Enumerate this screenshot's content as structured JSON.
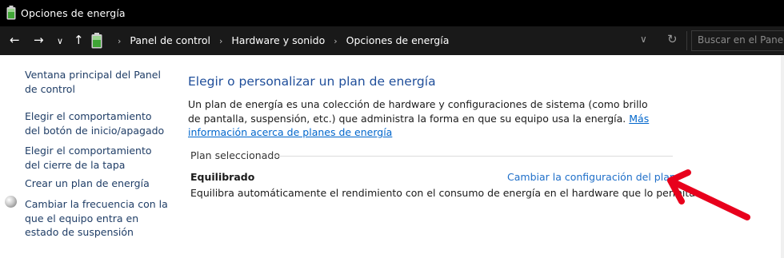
{
  "window": {
    "title": "Opciones de energía"
  },
  "nav": {
    "back_glyph": "←",
    "forward_glyph": "→",
    "history_glyph": "∨",
    "up_glyph": "↑",
    "breadcrumb": [
      "Panel de control",
      "Hardware y sonido",
      "Opciones de energía"
    ],
    "separator": "›",
    "dropdown_glyph": "∨",
    "refresh_glyph": "↻"
  },
  "search": {
    "placeholder": "Buscar en el Panel de control"
  },
  "sidebar": {
    "items": [
      {
        "label": "Ventana principal del Panel de control"
      },
      {
        "label": "Elegir el comportamiento del botón de inicio/apagado"
      },
      {
        "label": "Elegir el comportamiento del cierre de la tapa"
      },
      {
        "label": "Crear un plan de energía"
      },
      {
        "label": "Cambiar la frecuencia con la que el equipo entra en estado de suspensión"
      }
    ]
  },
  "main": {
    "heading": "Elegir o personalizar un plan de energía",
    "description": "Un plan de energía es una colección de hardware y configuraciones de sistema (como brillo de pantalla, suspensión, etc.) que administra la forma en que su equipo usa la energía.",
    "more_info_link": "Más información acerca de planes de energía",
    "group_label": "Plan seleccionado",
    "plan": {
      "name": "Equilibrado",
      "change_link": "Cambiar la configuración del plan",
      "description": "Equilibra automáticamente el rendimiento con el consumo de energía en el hardware que lo permita."
    }
  },
  "icons": {
    "app": "battery-icon",
    "breadcrumb": "battery-icon",
    "sidebar_item_5": "shield-icon",
    "annotation": "red-arrow-icon"
  },
  "colors": {
    "titlebar": "#000000",
    "navbar": "#191919",
    "heading": "#1f4e9a",
    "link": "#1f6fc9",
    "annotation": "#e8001c"
  }
}
